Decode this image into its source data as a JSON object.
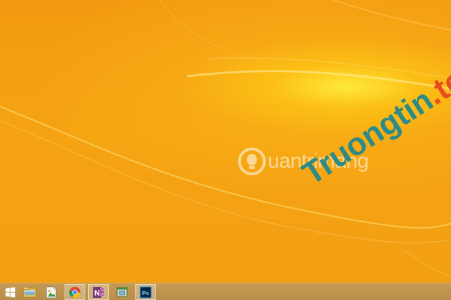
{
  "desktop": {
    "background_color": "#f5a312",
    "highlight_color": "#ffec3c"
  },
  "watermarks": {
    "brand_text": "uantrimang",
    "overlay_part1": "Truongtin",
    "overlay_part2": ".top"
  },
  "taskbar": {
    "background_color": "#bf9450",
    "items": [
      {
        "name": "start-button",
        "icon": "windows-logo-icon",
        "active": false
      },
      {
        "name": "file-explorer-button",
        "icon": "folder-icon",
        "active": false
      },
      {
        "name": "image-viewer-button",
        "icon": "image-file-icon",
        "active": false
      },
      {
        "name": "chrome-button",
        "icon": "chrome-icon",
        "active": true
      },
      {
        "name": "onenote-button",
        "icon": "onenote-icon",
        "active": true
      },
      {
        "name": "window-app-button",
        "icon": "window-app-icon",
        "active": false
      },
      {
        "name": "photoshop-button",
        "icon": "photoshop-icon",
        "active": true
      }
    ],
    "onenote_letter": "N",
    "photoshop_letters": "Ps"
  }
}
